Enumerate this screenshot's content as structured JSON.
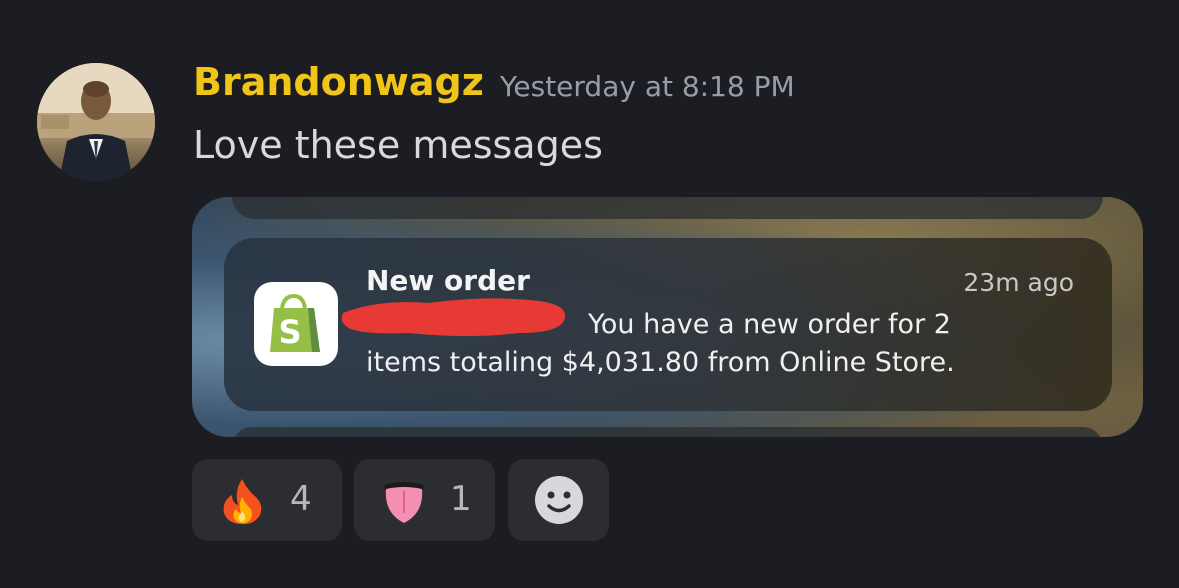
{
  "message": {
    "author": "Brandonwagz",
    "author_color": "#f0c419",
    "timestamp": "Yesterday at 8:18 PM",
    "text": "Love these messages"
  },
  "embed": {
    "app_icon": "shopify-bag-icon",
    "app_color": "#95bf47",
    "title": "New order",
    "time": "23m ago",
    "body_line1": "You have a new order for 2",
    "body_line2": "items totaling $4,031.80 from Online Store.",
    "redaction_color": "#e83a35"
  },
  "reactions": [
    {
      "emoji": "fire-emoji",
      "count": "4"
    },
    {
      "emoji": "tongue-emoji",
      "count": "1"
    }
  ],
  "add_reaction": {
    "icon": "smiley-icon"
  }
}
